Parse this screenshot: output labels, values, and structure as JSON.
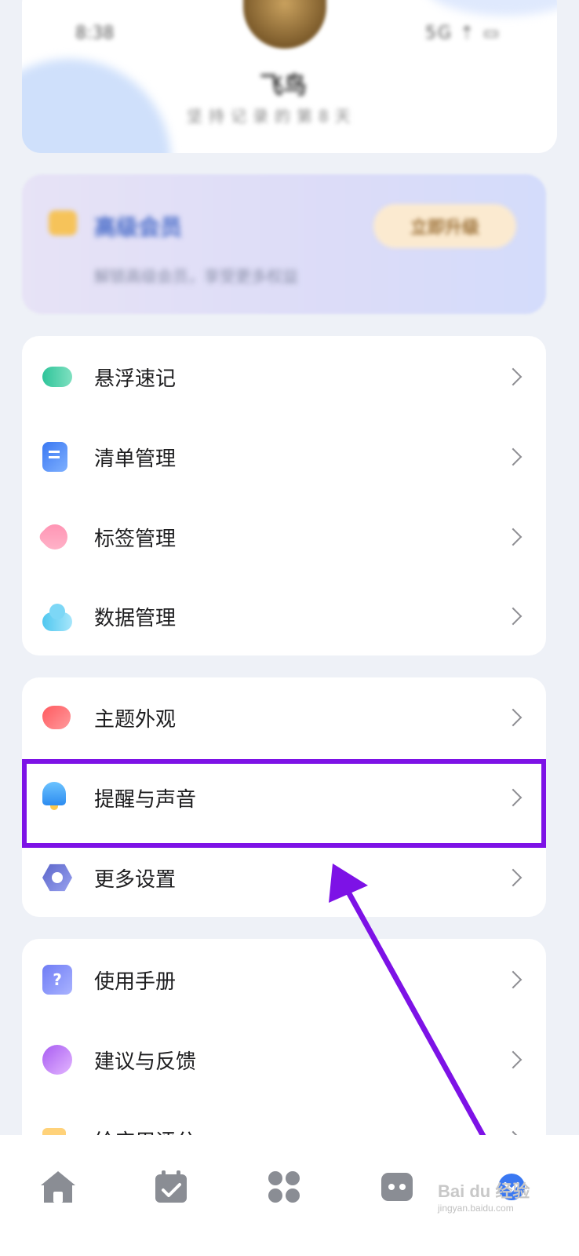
{
  "header": {
    "status_time": "8:38",
    "status_right": "5G ⇡ ▭",
    "nickname": "飞鸟",
    "subtitle": "坚持记录的第8天"
  },
  "member": {
    "title": "高级会员",
    "subtitle": "解锁高级会员，享受更多权益",
    "upgrade_label": "立即升级"
  },
  "groups": [
    {
      "items": [
        {
          "label": "悬浮速记",
          "icon": "float-note-icon"
        },
        {
          "label": "清单管理",
          "icon": "list-icon"
        },
        {
          "label": "标签管理",
          "icon": "tag-icon"
        },
        {
          "label": "数据管理",
          "icon": "cloud-icon"
        }
      ]
    },
    {
      "items": [
        {
          "label": "主题外观",
          "icon": "heart-icon"
        },
        {
          "label": "提醒与声音",
          "icon": "bell-icon",
          "highlighted": true
        },
        {
          "label": "更多设置",
          "icon": "gear-hex-icon"
        }
      ]
    },
    {
      "items": [
        {
          "label": "使用手册",
          "icon": "help-icon"
        },
        {
          "label": "建议与反馈",
          "icon": "feedback-icon"
        },
        {
          "label": "给应用评分",
          "icon": "thumb-icon"
        }
      ]
    }
  ],
  "bottom_nav": [
    {
      "name": "home",
      "icon": "home-icon"
    },
    {
      "name": "calendar",
      "icon": "calendar-check-icon"
    },
    {
      "name": "apps",
      "icon": "four-grid-icon"
    },
    {
      "name": "assistant",
      "icon": "robot-icon"
    },
    {
      "name": "me",
      "icon": "profile-icon",
      "active": true
    }
  ],
  "colors": {
    "highlight": "#7d12e6",
    "background": "#eef1f7",
    "accent": "#3a78f2"
  },
  "watermark": {
    "brand": "Bai du 经验",
    "url": "jingyan.baidu.com"
  }
}
